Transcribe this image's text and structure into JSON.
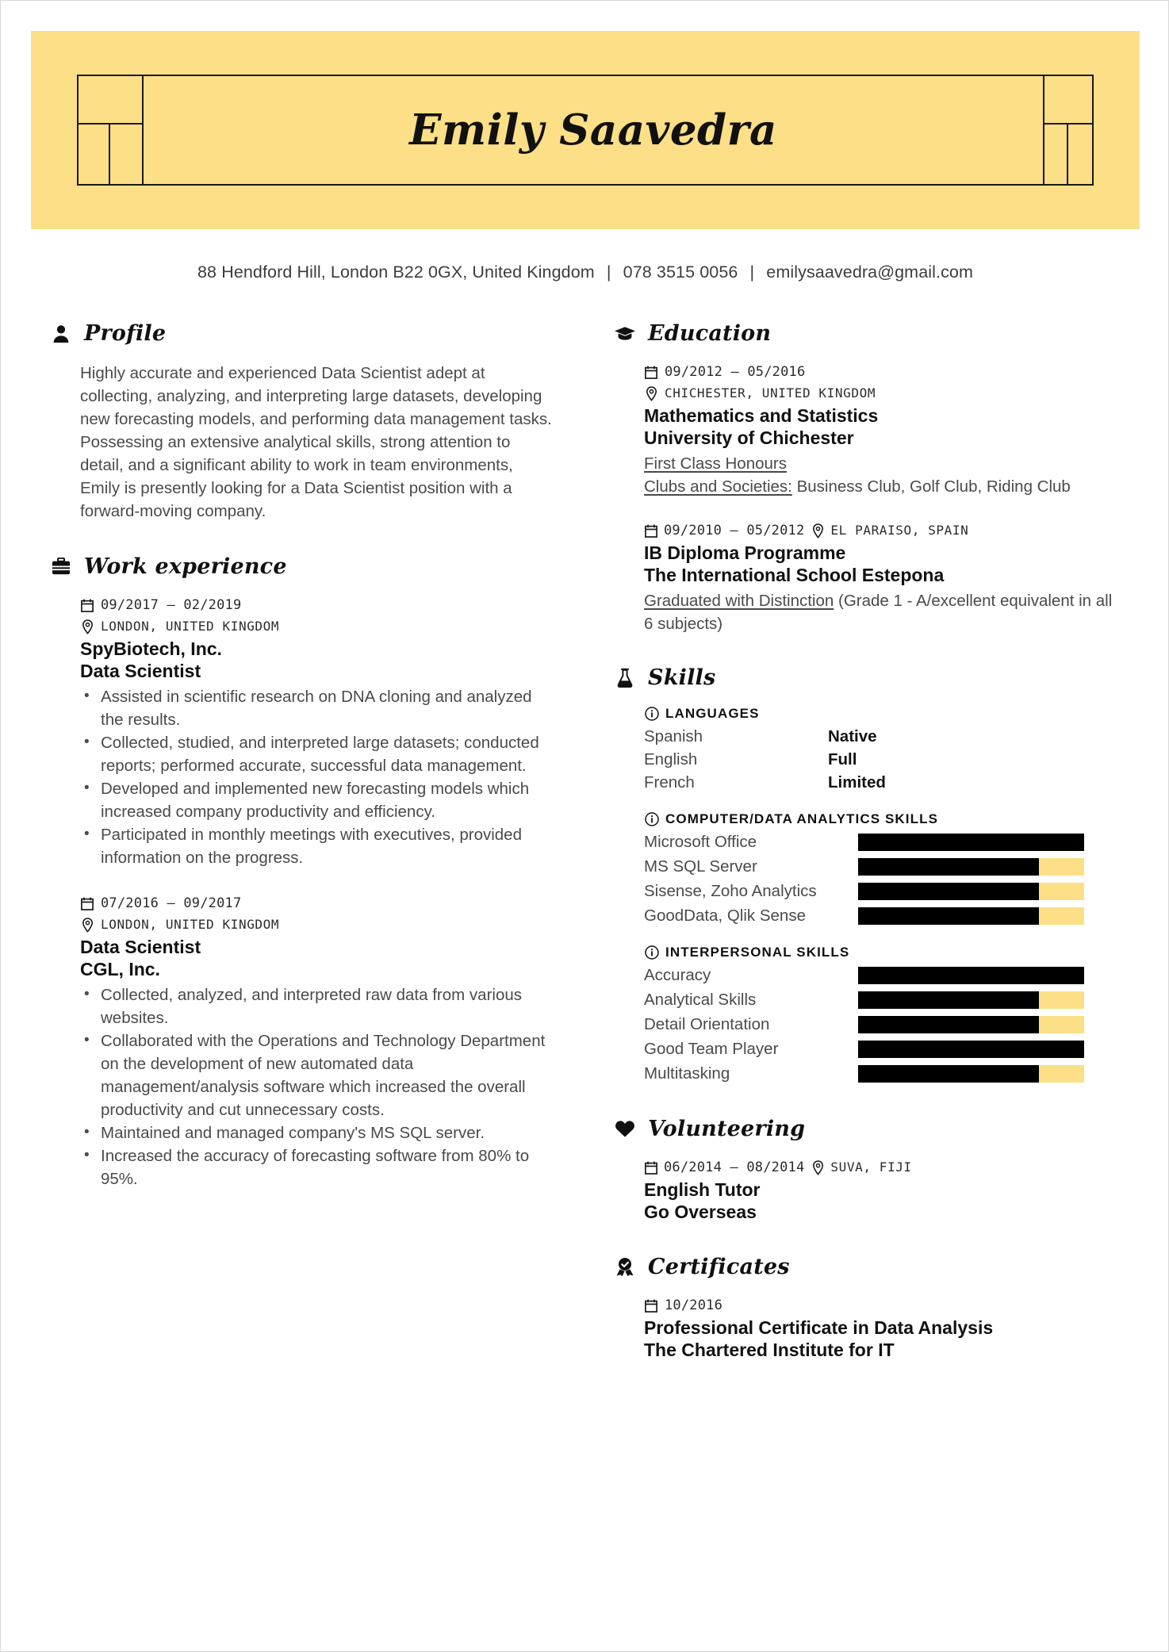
{
  "theme": {
    "accent": "#fcdf86",
    "ink": "#111111",
    "body": "#4a4a4a"
  },
  "header": {
    "name": "Emily Saavedra"
  },
  "contact": {
    "address": "88 Hendford Hill, London B22 0GX, United Kingdom",
    "phone": "078 3515 0056",
    "email": "emilysaavedra@gmail.com",
    "separator": "|"
  },
  "profile": {
    "heading": "Profile",
    "icon": "person-icon",
    "paragraphs": [
      "Highly accurate and experienced Data Scientist adept at collecting, analyzing, and interpreting large datasets, developing new forecasting models, and performing data management tasks.",
      "Possessing an extensive analytical skills, strong attention to detail, and a significant ability to work in team environments, Emily is presently looking for a Data Scientist position with a forward-moving company."
    ]
  },
  "work": {
    "heading": "Work experience",
    "icon": "briefcase-icon",
    "entries": [
      {
        "dates": "09/2017 – 02/2019",
        "location": "LONDON, UNITED KINGDOM",
        "title": "SpyBiotech, Inc.",
        "subtitle": "Data Scientist",
        "bullets": [
          "Assisted in scientific research on DNA cloning and analyzed the results.",
          "Collected, studied, and interpreted large datasets; conducted reports; performed accurate, successful data management.",
          "Developed and implemented new forecasting models which increased company productivity and efficiency.",
          "Participated in monthly meetings with executives, provided information on the progress."
        ]
      },
      {
        "dates": "07/2016 – 09/2017",
        "location": "LONDON, UNITED KINGDOM",
        "title": "Data Scientist",
        "subtitle": "CGL, Inc.",
        "bullets": [
          "Collected, analyzed, and interpreted raw data from various websites.",
          "Collaborated with the Operations and Technology Department on the development of new automated data management/analysis software which increased the overall productivity and cut unnecessary costs.",
          "Maintained and managed company's MS SQL server.",
          "Increased the accuracy of forecasting software from 80% to 95%."
        ]
      }
    ]
  },
  "education": {
    "heading": "Education",
    "icon": "graduation-cap-icon",
    "entries": [
      {
        "dates": "09/2012 – 05/2016",
        "location": "CHICHESTER, UNITED KINGDOM",
        "location_inline": false,
        "title": "Mathematics and Statistics",
        "subtitle": "University of Chichester",
        "honour": "First Class Honours",
        "extra_label": "Clubs and Societies:",
        "extra_value": " Business Club, Golf Club, Riding Club"
      },
      {
        "dates": "09/2010 – 05/2012",
        "location": "EL PARAISO, SPAIN",
        "location_inline": true,
        "title": "IB Diploma Programme",
        "subtitle": "The International School Estepona",
        "honour": "Graduated with Distinction",
        "extra_label": "",
        "extra_value": " (Grade 1 - A/excellent equivalent in all 6 subjects)"
      }
    ]
  },
  "skills": {
    "heading": "Skills",
    "icon": "flask-icon",
    "groups": [
      {
        "title": "LANGUAGES",
        "icon": "info-circle-icon",
        "type": "languages",
        "rows": [
          {
            "label": "Spanish",
            "level": "Native"
          },
          {
            "label": "English",
            "level": "Full"
          },
          {
            "label": "French",
            "level": "Limited"
          }
        ]
      },
      {
        "title": "COMPUTER/DATA ANALYTICS SKILLS",
        "icon": "info-circle-icon",
        "type": "bars",
        "rows": [
          {
            "label": "Microsoft Office",
            "value": 100
          },
          {
            "label": "MS SQL Server",
            "value": 80
          },
          {
            "label": "Sisense, Zoho Analytics",
            "value": 80
          },
          {
            "label": "GoodData, Qlik Sense",
            "value": 80
          }
        ]
      },
      {
        "title": "INTERPERSONAL SKILLS",
        "icon": "info-circle-icon",
        "type": "bars",
        "rows": [
          {
            "label": "Accuracy",
            "value": 100
          },
          {
            "label": "Analytical Skills",
            "value": 80
          },
          {
            "label": "Detail Orientation",
            "value": 80
          },
          {
            "label": "Good Team Player",
            "value": 100
          },
          {
            "label": "Multitasking",
            "value": 80
          }
        ]
      }
    ]
  },
  "volunteering": {
    "heading": "Volunteering",
    "icon": "heart-icon",
    "entries": [
      {
        "dates": "06/2014 – 08/2014",
        "location": "SUVA, FIJI",
        "title": "English Tutor",
        "subtitle": "Go Overseas"
      }
    ]
  },
  "certificates": {
    "heading": "Certificates",
    "icon": "award-icon",
    "entries": [
      {
        "dates": "10/2016",
        "title": "Professional Certificate in Data Analysis",
        "subtitle": "The Chartered Institute for IT"
      }
    ]
  }
}
